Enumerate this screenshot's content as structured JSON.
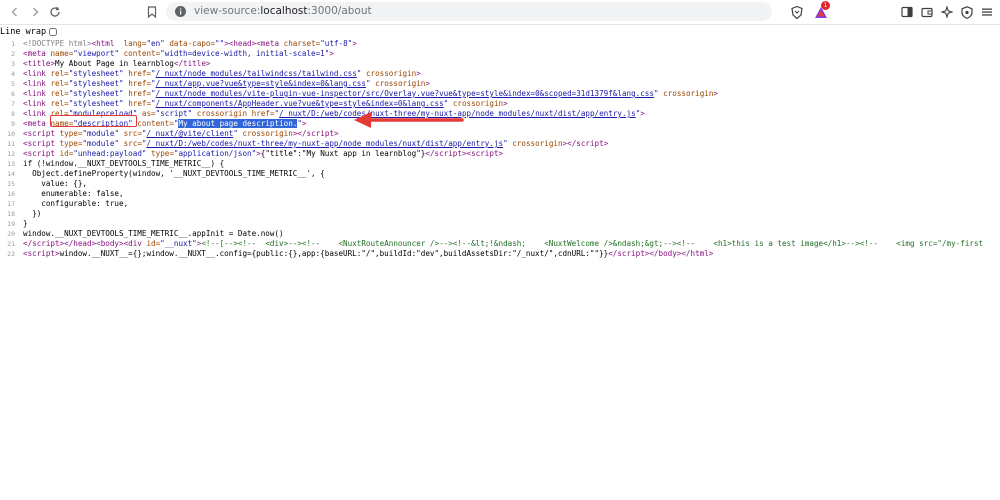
{
  "browser": {
    "url_prefix": "view-source:",
    "url_host": "localhost",
    "url_path": ":3000/about",
    "badge_count": "1",
    "icons": [
      "back-icon",
      "forward-icon",
      "reload-icon",
      "bookmark-icon",
      "info-icon",
      "brave-shield-icon",
      "brave-rewards-icon",
      "sidebar-icon",
      "wallet-icon",
      "leo-ai-icon",
      "vpn-icon",
      "menu-icon"
    ]
  },
  "view": {
    "line_wrap_label": "Line wrap"
  },
  "source_lines": [
    {
      "n": "1",
      "h": "<span class='dt'>&lt;!DOCTYPE html&gt;</span><span class='tag'>&lt;html</span>  <span class='attr'>lang=</span><span class='val'>\"en\"</span> <span class='attr'>data-capo=</span><span class='val'>\"\"</span><span class='tag'>&gt;&lt;head&gt;&lt;meta</span> <span class='attr'>charset=</span><span class='val'>\"utf-8\"</span><span class='tag'>&gt;</span>"
    },
    {
      "n": "2",
      "h": "<span class='tag'>&lt;meta</span> <span class='attr'>name=</span><span class='val'>\"viewport\"</span> <span class='attr'>content=</span><span class='val'>\"width=device-width, initial-scale=1\"</span><span class='tag'>&gt;</span>"
    },
    {
      "n": "3",
      "h": "<span class='tag'>&lt;title&gt;</span>My About Page in learnblog<span class='tag'>&lt;/title&gt;</span>"
    },
    {
      "n": "4",
      "h": "<span class='tag'>&lt;link</span> <span class='attr'>rel=</span><span class='val'>\"stylesheet\"</span> <span class='attr'>href=</span><span class='val'>\"</span><span class='url'>/_nuxt/node_modules/tailwindcss/tailwind.css</span><span class='val'>\"</span> <span class='attr'>crossorigin</span><span class='tag'>&gt;</span>"
    },
    {
      "n": "5",
      "h": "<span class='tag'>&lt;link</span> <span class='attr'>rel=</span><span class='val'>\"stylesheet\"</span> <span class='attr'>href=</span><span class='val'>\"</span><span class='url'>/_nuxt/app.vue?vue&amp;type=style&amp;index=0&amp;lang.css</span><span class='val'>\"</span> <span class='attr'>crossorigin</span><span class='tag'>&gt;</span>"
    },
    {
      "n": "6",
      "h": "<span class='tag'>&lt;link</span> <span class='attr'>rel=</span><span class='val'>\"stylesheet\"</span> <span class='attr'>href=</span><span class='val'>\"</span><span class='url'>/_nuxt/node_modules/vite-plugin-vue-inspector/src/Overlay.vue?vue&amp;type=style&amp;index=0&amp;scoped=31d1379f&amp;lang.css</span><span class='val'>\"</span> <span class='attr'>crossorigin</span><span class='tag'>&gt;</span>"
    },
    {
      "n": "7",
      "h": "<span class='tag'>&lt;link</span> <span class='attr'>rel=</span><span class='val'>\"stylesheet\"</span> <span class='attr'>href=</span><span class='val'>\"</span><span class='url'>/_nuxt/components/AppHeader.vue?vue&amp;type=style&amp;index=0&amp;lang.css</span><span class='val'>\"</span> <span class='attr'>crossorigin</span><span class='tag'>&gt;</span>"
    },
    {
      "n": "8",
      "h": "<span class='tag'>&lt;link</span> <span class='attr'>rel=</span><span class='val'>\"modulepreload\"</span> <span class='attr'>as=</span><span class='val'>\"script\"</span> <span class='attr'>crossorigin</span> <span class='attr'>href=</span><span class='val'>\"</span><span class='url'>/_nuxt/D:/web/codes/nuxt-three/my-nuxt-app/node_modules/nuxt/dist/app/entry.js</span><span class='val'>\"</span><span class='tag'>&gt;</span>"
    },
    {
      "n": "9",
      "h": "<span class='tag'>&lt;meta</span> <span class='attr'>name=</span><span class='val'>\"description\"</span> <span class='attr'>content=</span><span class='val'>\"</span><span class='hl'>My about page description.</span><span class='val'>\"</span><span class='tag'>&gt;</span>"
    },
    {
      "n": "10",
      "h": "<span class='tag'>&lt;script</span> <span class='attr'>type=</span><span class='val'>\"module\"</span> <span class='attr'>src=</span><span class='val'>\"</span><span class='url'>/_nuxt/@vite/client</span><span class='val'>\"</span> <span class='attr'>crossorigin</span><span class='tag'>&gt;&lt;/script&gt;</span>"
    },
    {
      "n": "11",
      "h": "<span class='tag'>&lt;script</span> <span class='attr'>type=</span><span class='val'>\"module\"</span> <span class='attr'>src=</span><span class='val'>\"</span><span class='url'>/_nuxt/D:/web/codes/nuxt-three/my-nuxt-app/node_modules/nuxt/dist/app/entry.js</span><span class='val'>\"</span> <span class='attr'>crossorigin</span><span class='tag'>&gt;&lt;/script&gt;</span>"
    },
    {
      "n": "12",
      "h": "<span class='tag'>&lt;script</span> <span class='attr'>id=</span><span class='val'>\"unhead:payload\"</span> <span class='attr'>type=</span><span class='val'>\"application/json\"</span><span class='tag'>&gt;</span>{\"title\":\"My Nuxt app in learnblog\"}<span class='tag'>&lt;/script&gt;&lt;script&gt;</span>"
    },
    {
      "n": "13",
      "h": "if (!window.__NUXT_DEVTOOLS_TIME_METRIC__) {"
    },
    {
      "n": "14",
      "h": "  Object.defineProperty(window, '__NUXT_DEVTOOLS_TIME_METRIC__', {"
    },
    {
      "n": "15",
      "h": "    value: {},"
    },
    {
      "n": "16",
      "h": "    enumerable: false,"
    },
    {
      "n": "17",
      "h": "    configurable: true,"
    },
    {
      "n": "18",
      "h": "  })"
    },
    {
      "n": "19",
      "h": "}"
    },
    {
      "n": "20",
      "h": "window.__NUXT_DEVTOOLS_TIME_METRIC__.appInit = Date.now()"
    },
    {
      "n": "21",
      "h": "<span class='tag'>&lt;/script&gt;&lt;/head&gt;&lt;body&gt;&lt;div</span> <span class='attr'>id=</span><span class='val'>\"__nuxt\"</span><span class='tag'>&gt;</span><span class='cmt'>&lt;!--[--&gt;&lt;!--  &lt;div&gt;--&gt;&lt;!--    &lt;NuxtRouteAnnouncer /&gt;--&gt;&lt;!--&amp;lt;!&amp;ndash;    &lt;NuxtWelcome /&gt;&amp;ndash;&amp;gt;--&gt;&lt;!--    &lt;h1&gt;this is a test image&lt;/h1&gt;--&gt;&lt;!--    &lt;img src=\"/my-first</span>"
    },
    {
      "n": "22",
      "h": "<span class='tag'>&lt;script&gt;</span>window.__NUXT__={};window.__NUXT__.config={public:{},app:{baseURL:\"/\",buildId:\"dev\",buildAssetsDir:\"/_nuxt/\",cdnURL:\"\"}}<span class='tag'>&lt;/script&gt;&lt;/body&gt;&lt;/html&gt;</span>"
    }
  ]
}
